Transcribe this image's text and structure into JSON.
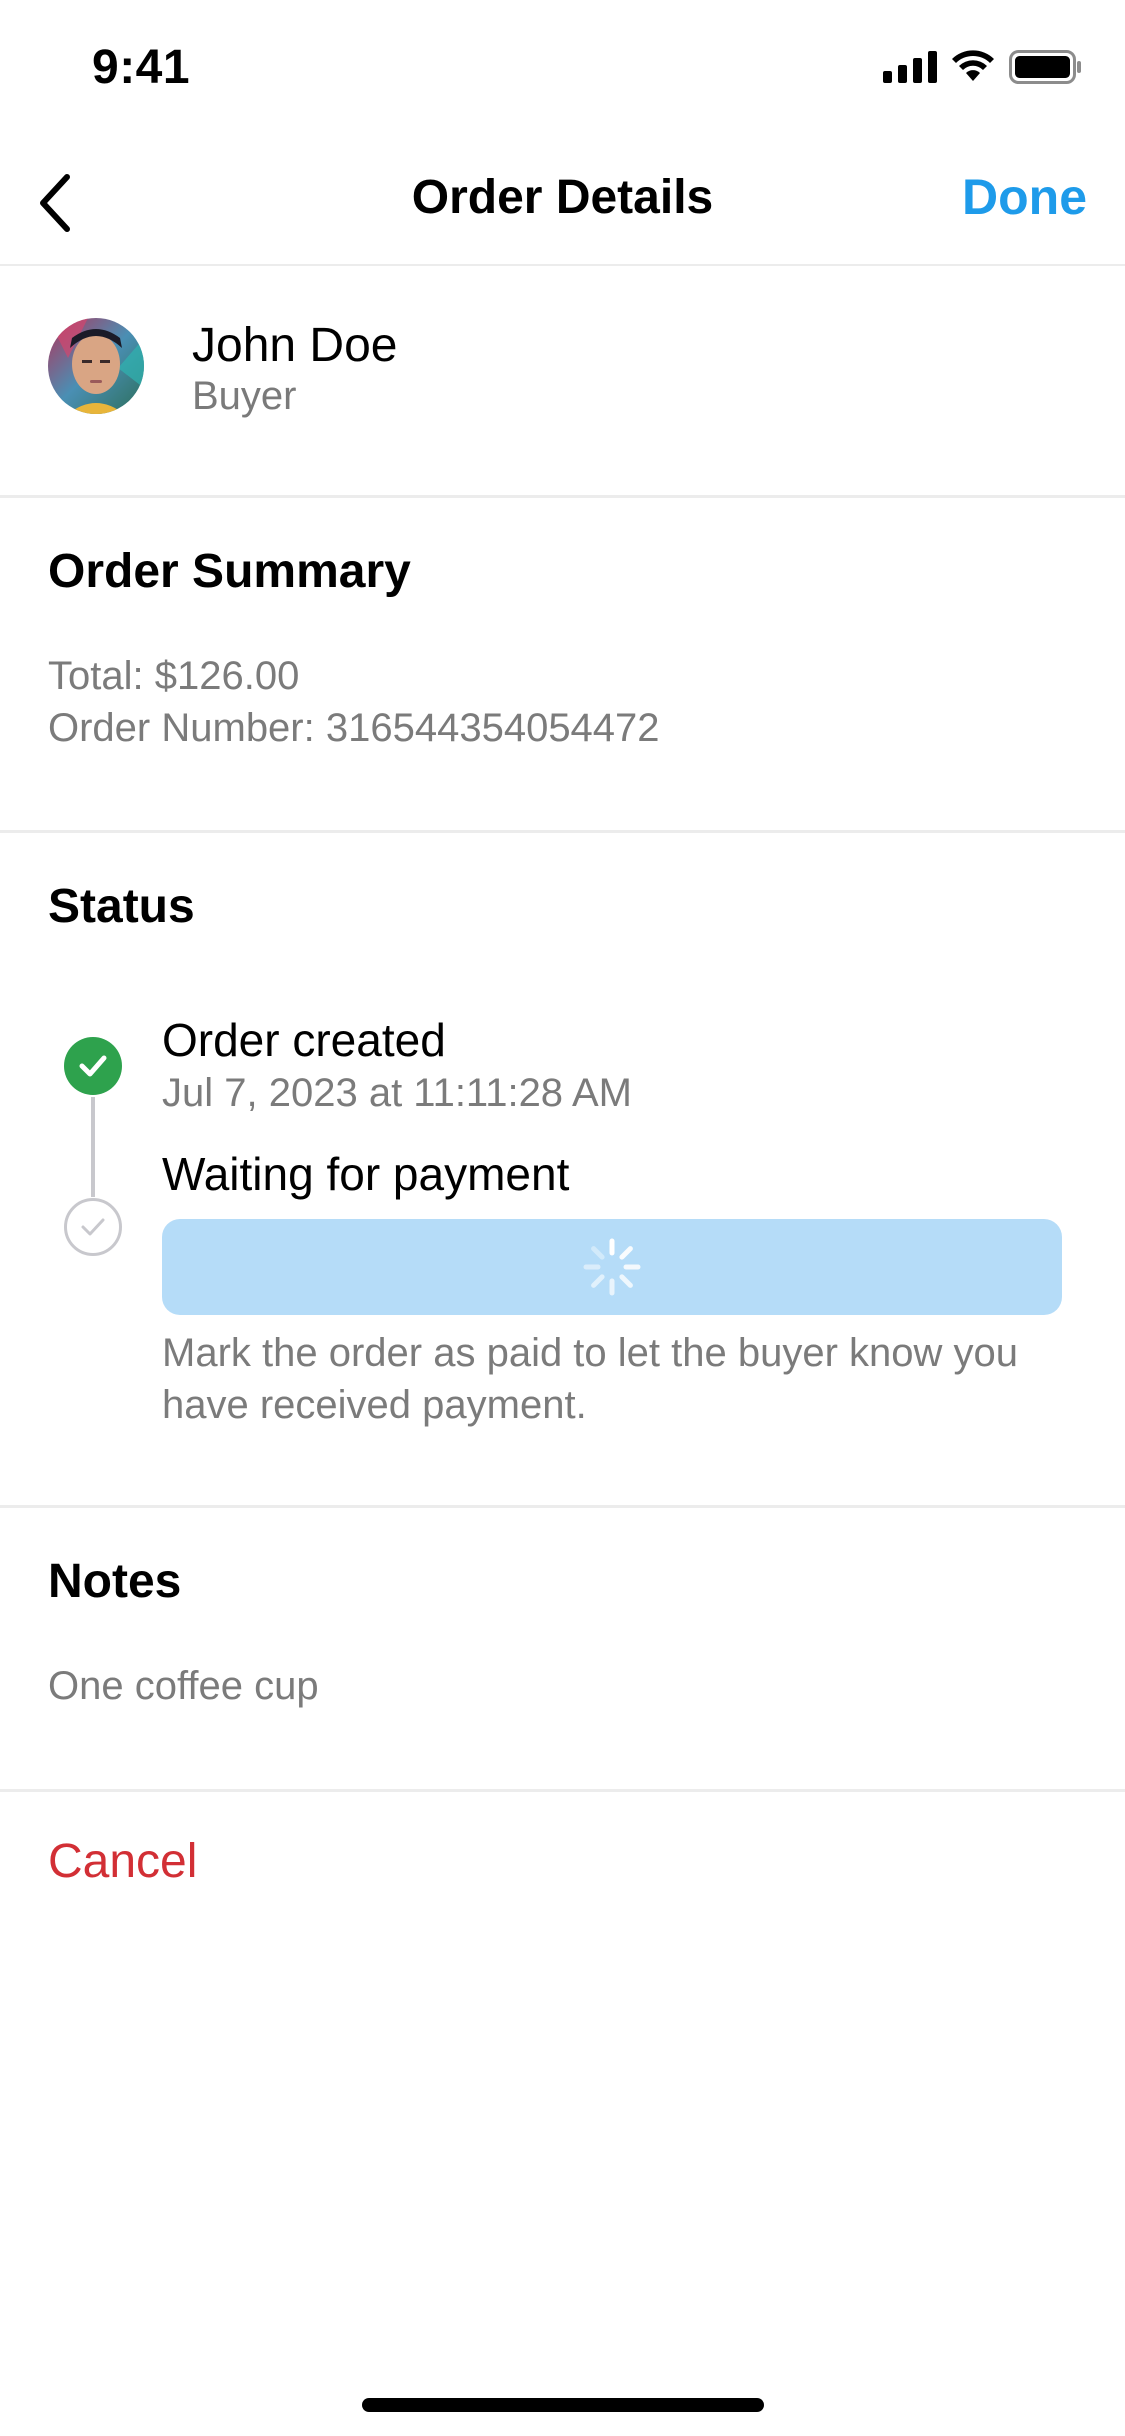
{
  "status_bar": {
    "time": "9:41"
  },
  "nav": {
    "title": "Order Details",
    "done_label": "Done"
  },
  "buyer": {
    "name": "John Doe",
    "role": "Buyer"
  },
  "summary": {
    "title": "Order Summary",
    "total": "Total: $126.00",
    "order_number": "Order Number: 316544354054472"
  },
  "status": {
    "title": "Status",
    "steps": [
      {
        "label": "Order created",
        "timestamp": "Jul 7, 2023 at 11:11:28 AM",
        "state": "completed"
      },
      {
        "label": "Waiting for payment",
        "state": "pending"
      }
    ],
    "help_text": "Mark the order as paid to let the buyer know you have received payment."
  },
  "notes": {
    "title": "Notes",
    "text": "One coffee cup"
  },
  "actions": {
    "cancel_label": "Cancel"
  },
  "colors": {
    "accent": "#1e9bea",
    "success": "#2ea24d",
    "danger": "#d22f35",
    "button_loading": "#b5dcf8"
  }
}
